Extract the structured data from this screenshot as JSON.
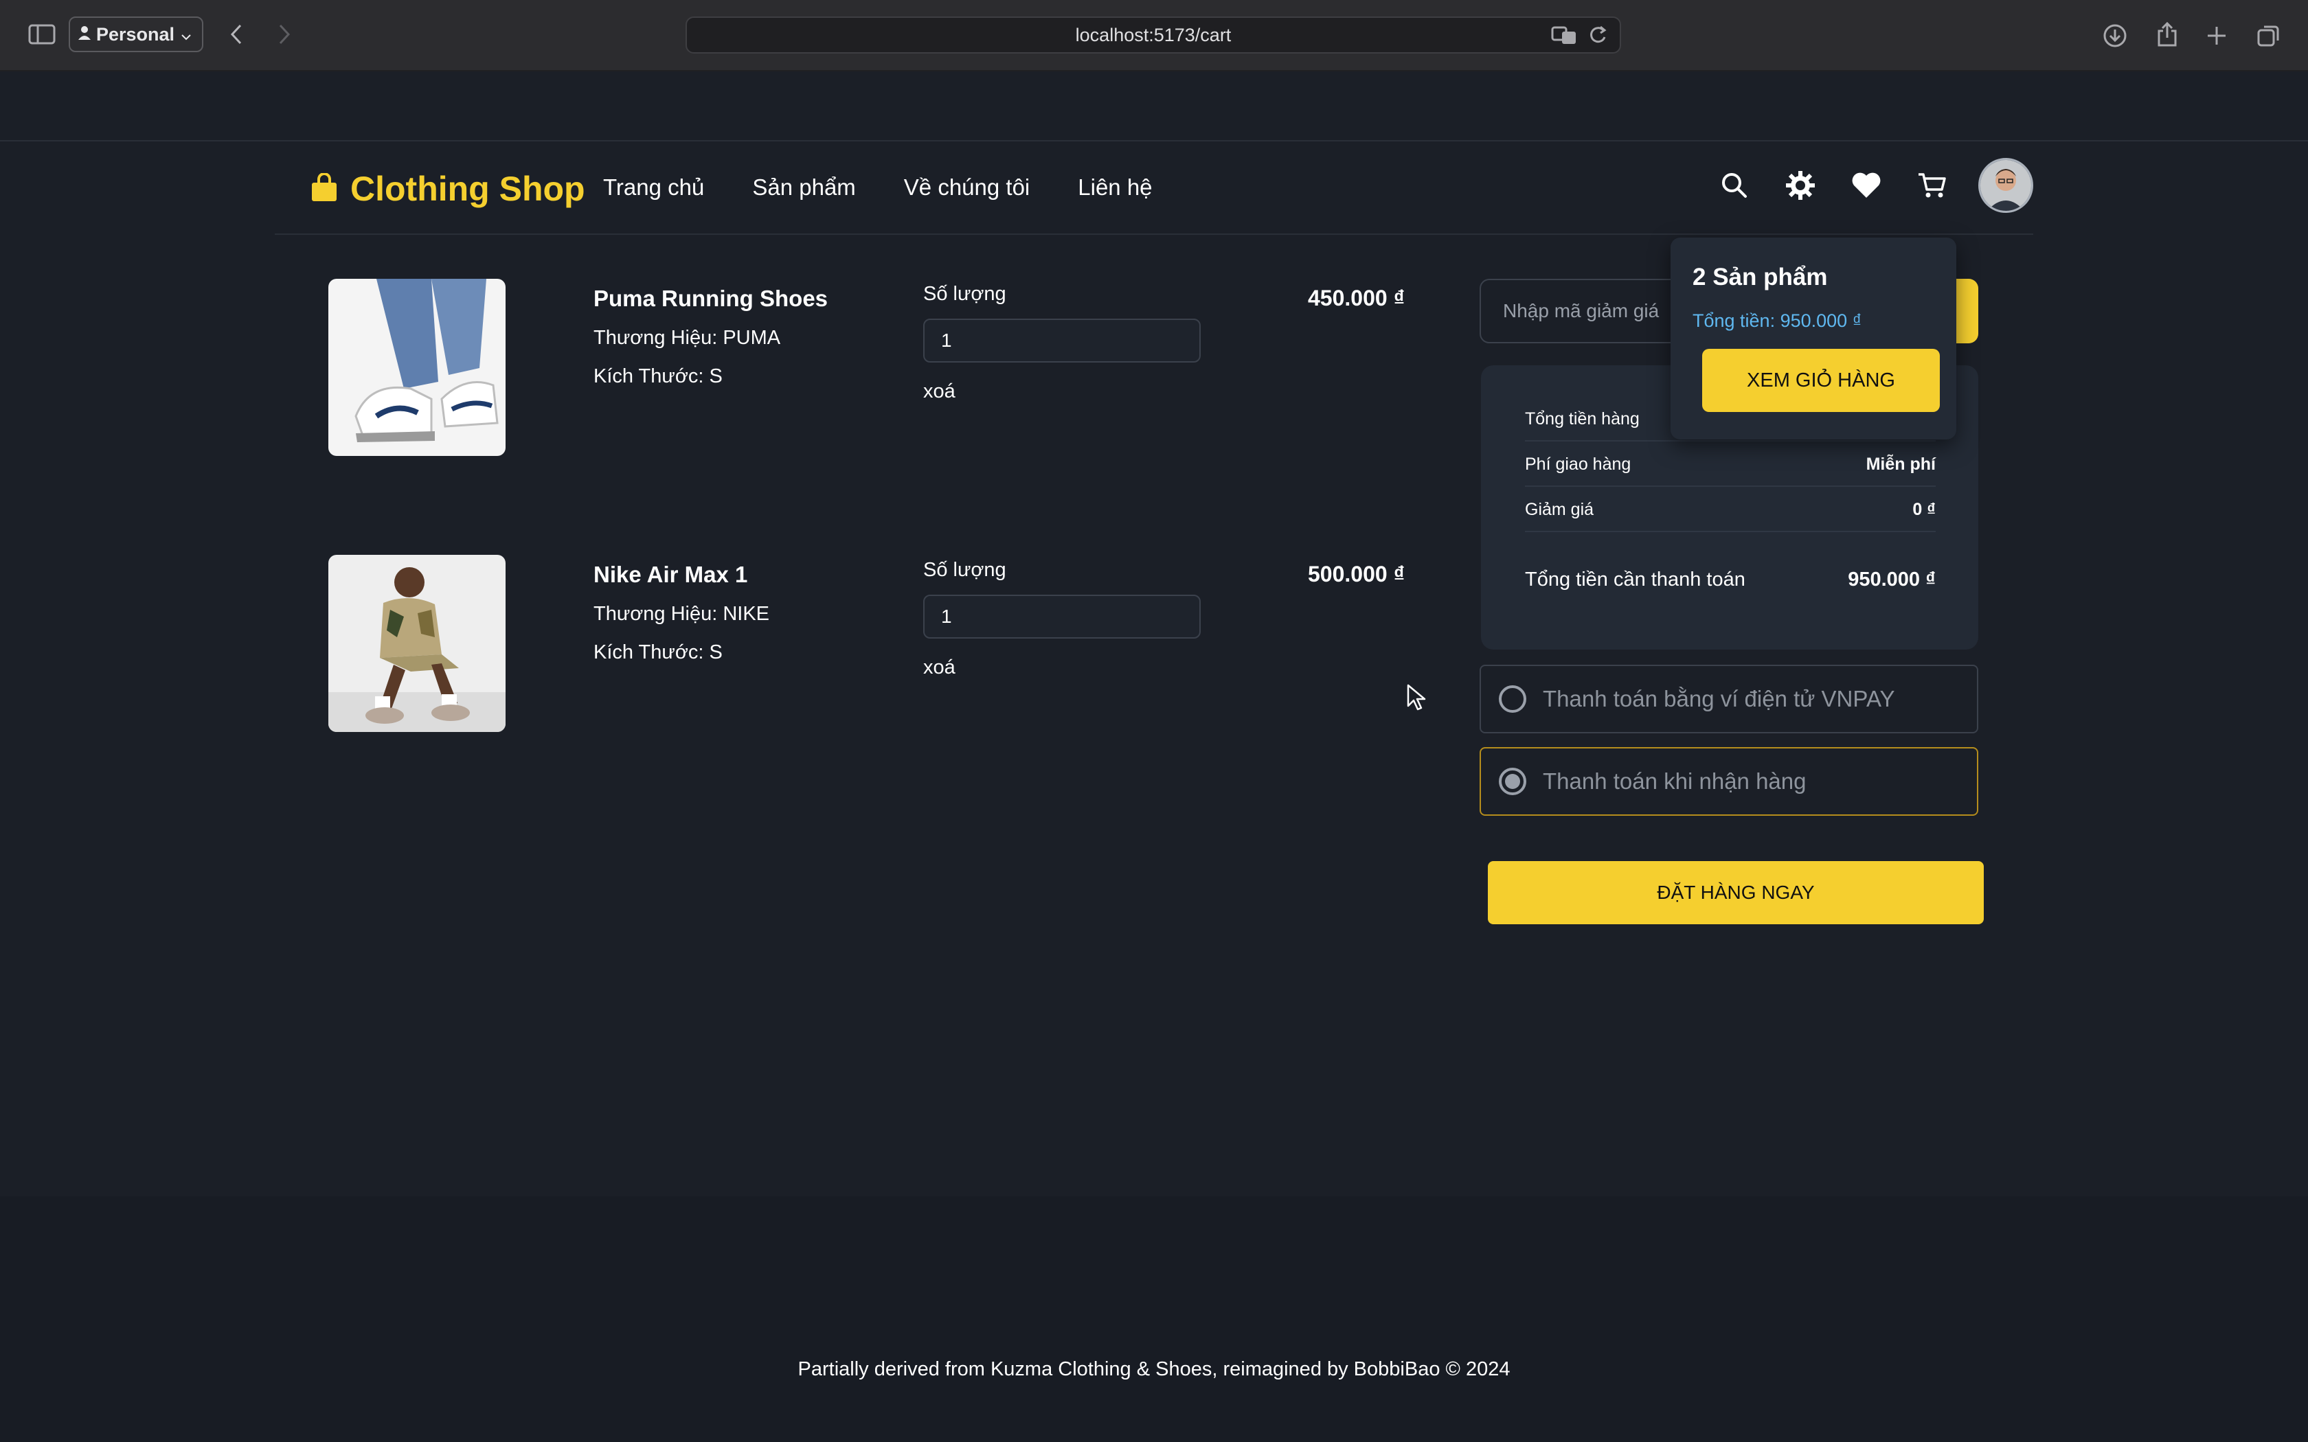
{
  "browser": {
    "profile_label": "Personal",
    "url": "localhost:5173/cart"
  },
  "header": {
    "brand": "Clothing Shop",
    "nav": [
      "Trang chủ",
      "Sản phẩm",
      "Về chúng tôi",
      "Liên hệ"
    ]
  },
  "cart": {
    "quantity_label": "Số lượng",
    "remove_label": "xoá",
    "items": [
      {
        "name": "Puma Running Shoes",
        "brand": "Thương Hiệu: PUMA",
        "size": "Kích Thước: S",
        "quantity": "1",
        "price": "450.000 ₫"
      },
      {
        "name": "Nike Air Max 1",
        "brand": "Thương Hiệu: NIKE",
        "size": "Kích Thước: S",
        "quantity": "1",
        "price": "500.000 ₫"
      }
    ]
  },
  "summary": {
    "coupon_placeholder": "Nhập mã giảm giá",
    "rows": [
      {
        "label": "Tổng tiền hàng",
        "value": ""
      },
      {
        "label": "Phí giao hàng",
        "value": "Miễn phí"
      },
      {
        "label": "Giảm giá",
        "value": "0 ₫"
      }
    ],
    "total_label": "Tổng tiền cần thanh toán",
    "total_value": "950.000 ₫"
  },
  "payment": {
    "options": [
      "Thanh toán bằng ví điện tử VNPAY",
      "Thanh toán khi nhận hàng"
    ],
    "selected": "Thanh toán khi nhận hàng"
  },
  "order_button": "ĐẶT HÀNG NGAY",
  "cart_popup": {
    "count": "2 Sản phẩm",
    "total": "Tổng tiền: 950.000 ₫",
    "button": "XEM GIỎ HÀNG"
  },
  "footer": "Partially derived from Kuzma Clothing & Shoes, reimagined by BobbiBao © 2024",
  "colors": {
    "accent": "#f5cf2f",
    "background": "#1b1f27",
    "panel": "#232a35",
    "link_blue": "#5fb8f0"
  }
}
